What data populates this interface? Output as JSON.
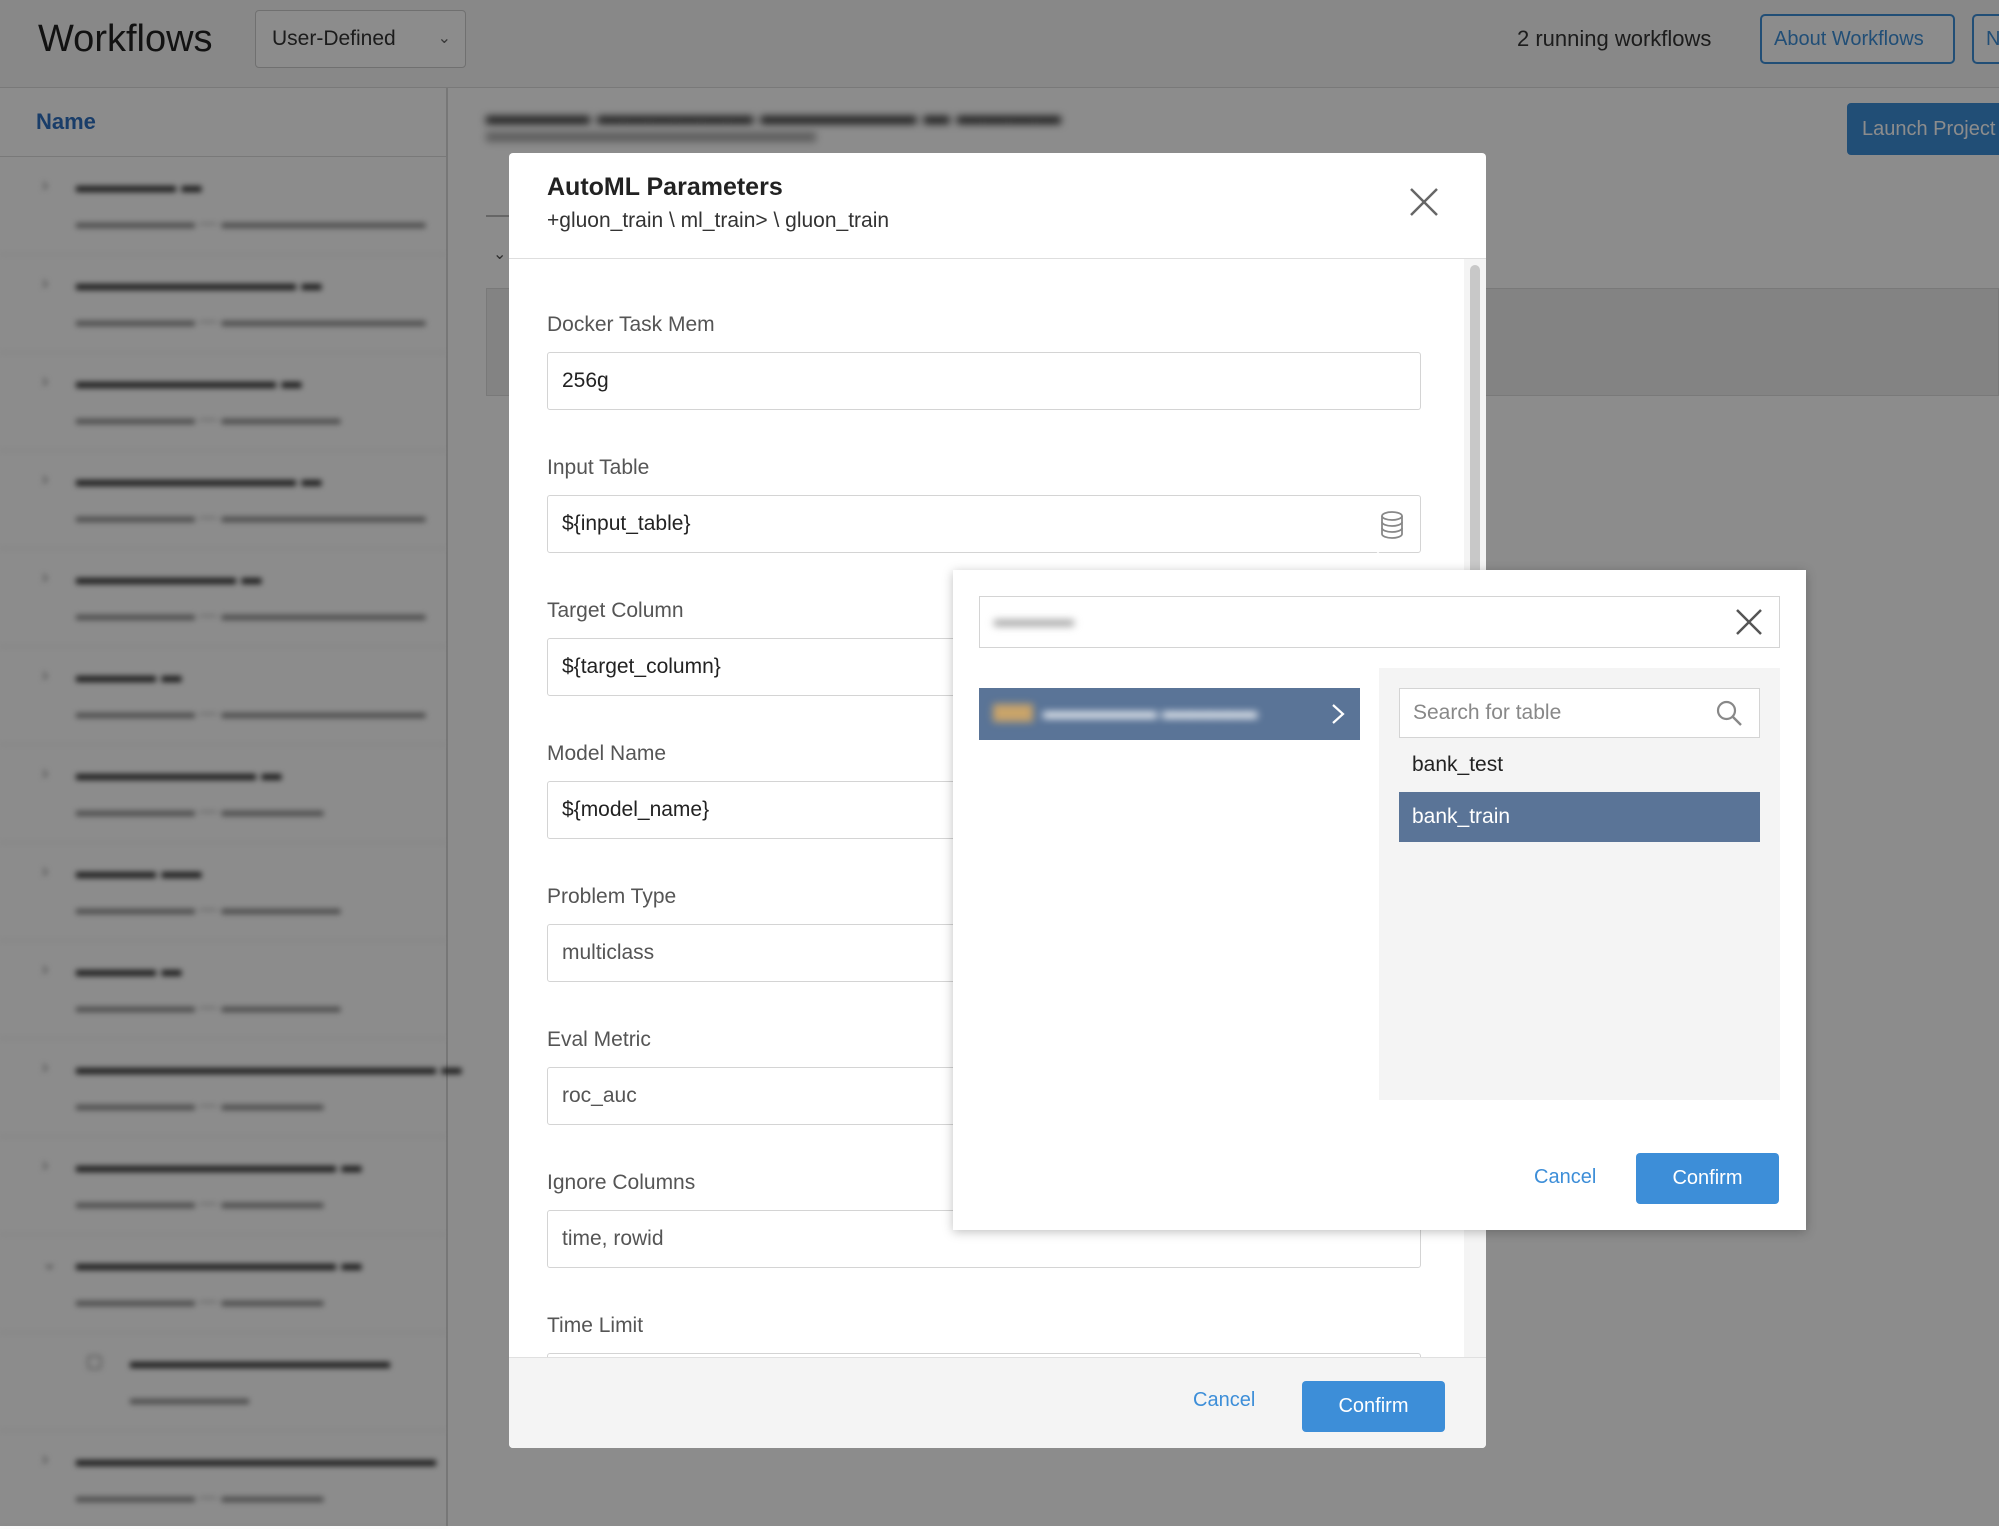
{
  "header": {
    "title": "Workflows",
    "filter_value": "User-Defined",
    "running_status": "2 running workflows",
    "about_button": "About Workflows",
    "new_button_partial": "N"
  },
  "sidebar": {
    "column_header": "Name"
  },
  "detail": {
    "launch_button": "Launch Project"
  },
  "modal": {
    "title": "AutoML Parameters",
    "path": "+gluon_train \\ ml_train> \\ gluon_train",
    "fields": [
      {
        "label": "Docker Task Mem",
        "value": "256g"
      },
      {
        "label": "Input Table",
        "value": "${input_table}"
      },
      {
        "label": "Target Column",
        "value": "${target_column}"
      },
      {
        "label": "Model Name",
        "value": "${model_name}"
      },
      {
        "label": "Problem Type",
        "value": "multiclass"
      },
      {
        "label": "Eval Metric",
        "value": "roc_auc"
      },
      {
        "label": "Ignore Columns",
        "value": "time, rowid"
      },
      {
        "label": "Time Limit",
        "value": ""
      }
    ],
    "cancel": "Cancel",
    "confirm": "Confirm"
  },
  "table_picker": {
    "table_search_placeholder": "Search for table",
    "tables": [
      {
        "name": "bank_test",
        "selected": false
      },
      {
        "name": "bank_train",
        "selected": true
      }
    ],
    "cancel": "Cancel",
    "confirm": "Confirm"
  },
  "colors": {
    "accent": "#3d8ed8",
    "selection": "#5a7497",
    "overlay": "rgba(0,0,0,0.45)"
  },
  "icons": {
    "modal_close": "close-icon",
    "input_table_picker": "database-icon",
    "popover_clear": "close-icon",
    "database_expand": "chevron-right-icon",
    "table_search": "search-icon",
    "filter_dropdown": "chevron-down-icon"
  }
}
